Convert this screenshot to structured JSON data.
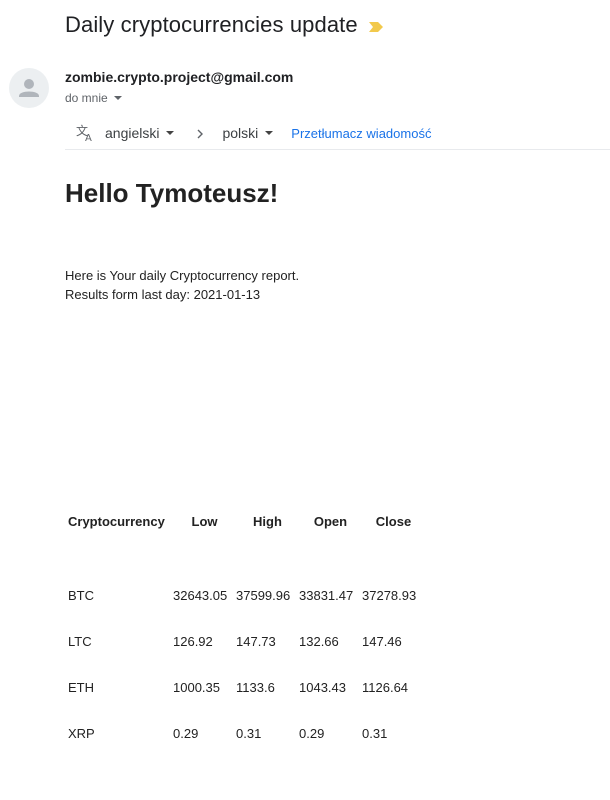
{
  "email": {
    "subject": "Daily cryptocurrencies update",
    "sender": "zombie.crypto.project@gmail.com",
    "recipient": "do mnie"
  },
  "translate": {
    "from_lang": "angielski",
    "to_lang": "polski",
    "link": "Przetłumacz wiadomość"
  },
  "body": {
    "greeting": "Hello Tymoteusz!",
    "intro_line1": "Here is Your daily Cryptocurrency report.",
    "intro_line2": "Results form last day: 2021-01-13"
  },
  "table": {
    "headers": [
      "Cryptocurrency",
      "Low",
      "High",
      "Open",
      "Close"
    ],
    "rows": [
      [
        "BTC",
        "32643.05",
        "37599.96",
        "33831.47",
        "37278.93"
      ],
      [
        "LTC",
        "126.92",
        "147.73",
        "132.66",
        "147.46"
      ],
      [
        "ETH",
        "1000.35",
        "1133.6",
        "1043.43",
        "1126.64"
      ],
      [
        "XRP",
        "0.29",
        "0.31",
        "0.29",
        "0.31"
      ]
    ]
  },
  "colors": {
    "importance": "#f2c94c",
    "link": "#1a73e8",
    "avatar_bg": "#eceff1"
  },
  "icons": [
    "importance-marker-icon",
    "avatar-person-icon",
    "translate-icon",
    "chevron-right-icon",
    "caret-down-icon"
  ]
}
